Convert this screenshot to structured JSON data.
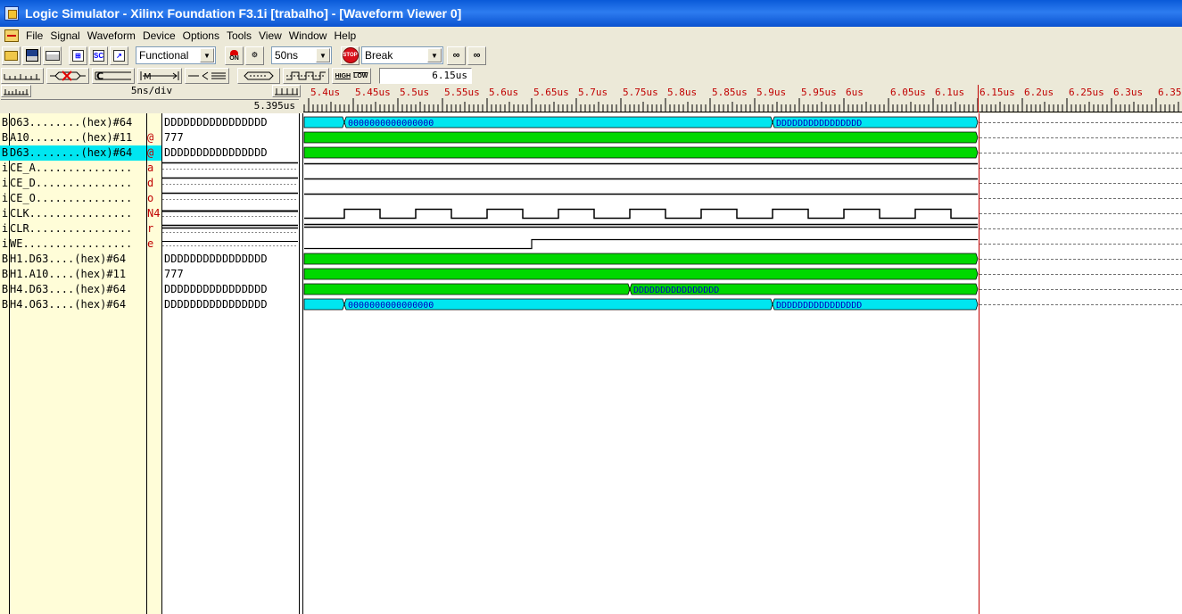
{
  "title_bar": {
    "title": "Logic Simulator - Xilinx Foundation F3.1i [trabalho] - [Waveform Viewer 0]"
  },
  "menu": [
    "File",
    "Signal",
    "Waveform",
    "Device",
    "Options",
    "Tools",
    "View",
    "Window",
    "Help"
  ],
  "toolbar": {
    "sim_mode": "Functional",
    "step_size": "50ns",
    "break_mode": "Break",
    "on_label": "ON",
    "sc_label": "SC",
    "stop_label": "STOP"
  },
  "waveform_toolbar": {
    "high_low_label_1": "HIGH",
    "high_low_label_2": "LOW",
    "time_value": "6.15us"
  },
  "header": {
    "scale": "5ns/div",
    "cursor_time": "5.395us"
  },
  "ruler": {
    "labels": [
      "5.4us",
      "5.45us",
      "5.5us",
      "5.55us",
      "5.6us",
      "5.65us",
      "5.7us",
      "5.75us",
      "5.8us",
      "5.85us",
      "5.9us",
      "5.95us",
      "6us",
      "6.05us",
      "6.1us",
      "6.15us",
      "6.2us",
      "6.25us",
      "6.3us",
      "6.35"
    ],
    "label_times": [
      5.4,
      5.45,
      5.5,
      5.55,
      5.6,
      5.65,
      5.7,
      5.75,
      5.8,
      5.85,
      5.9,
      5.95,
      6.0,
      6.05,
      6.1,
      6.15,
      6.2,
      6.25,
      6.3,
      6.35
    ],
    "start_time": 5.395,
    "end_marker": 6.15
  },
  "signals": [
    {
      "type": "B",
      "name": "O63........(hex)#64",
      "stim": "",
      "value": "DDDDDDDDDDDDDDDD",
      "kind": "bus",
      "color": "#00e6f0",
      "segments": [
        {
          "to": 5.44,
          "label": ""
        },
        {
          "to": 5.92,
          "label": "0000000000000000"
        },
        {
          "to": 6.15,
          "label": "DDDDDDDDDDDDDDDD"
        }
      ]
    },
    {
      "type": "B",
      "name": "A10........(hex)#11",
      "stim": "@",
      "value": "777",
      "kind": "bus",
      "color": "#00d800",
      "segments": [
        {
          "to": 6.15,
          "label": ""
        }
      ]
    },
    {
      "type": "B",
      "name": "D63........(hex)#64",
      "stim": "@",
      "value": "DDDDDDDDDDDDDDDD",
      "kind": "bus",
      "color": "#00d800",
      "selected": true,
      "segments": [
        {
          "to": 6.15,
          "label": ""
        }
      ]
    },
    {
      "type": "i",
      "name": "CE_A...............",
      "stim": "a",
      "value": "",
      "kind": "bit",
      "level": "high"
    },
    {
      "type": "i",
      "name": "CE_D...............",
      "stim": "d",
      "value": "",
      "kind": "bit",
      "level": "high"
    },
    {
      "type": "i",
      "name": "CE_O...............",
      "stim": "o",
      "value": "",
      "kind": "bit",
      "level": "high"
    },
    {
      "type": "i",
      "name": "CLK................",
      "stim": "N4",
      "value": "",
      "kind": "clock",
      "period": 0.08,
      "first_rise": 5.44
    },
    {
      "type": "i",
      "name": "CLR................",
      "stim": "r",
      "value": "",
      "kind": "bit",
      "level": "high2"
    },
    {
      "type": "i",
      "name": "WE.................",
      "stim": "e",
      "value": "",
      "kind": "step",
      "rise": 5.65
    },
    {
      "type": "B",
      "name": "H1.D63....(hex)#64",
      "stim": "",
      "value": "DDDDDDDDDDDDDDDD",
      "kind": "bus",
      "color": "#00d800",
      "segments": [
        {
          "to": 6.15,
          "label": ""
        }
      ]
    },
    {
      "type": "B",
      "name": "H1.A10....(hex)#11",
      "stim": "",
      "value": "777",
      "kind": "bus",
      "color": "#00d800",
      "segments": [
        {
          "to": 6.15,
          "label": ""
        }
      ]
    },
    {
      "type": "B",
      "name": "H4.D63....(hex)#64",
      "stim": "",
      "value": "DDDDDDDDDDDDDDDD",
      "kind": "bus",
      "color": "#00d800",
      "segments": [
        {
          "to": 5.76,
          "label": ""
        },
        {
          "to": 6.15,
          "label": "DDDDDDDDDDDDDDDD"
        }
      ]
    },
    {
      "type": "B",
      "name": "H4.O63....(hex)#64",
      "stim": "",
      "value": "DDDDDDDDDDDDDDDD",
      "kind": "bus",
      "color": "#00e6f0",
      "segments": [
        {
          "to": 5.44,
          "label": ""
        },
        {
          "to": 5.92,
          "label": "0000000000000000"
        },
        {
          "to": 6.15,
          "label": "DDDDDDDDDDDDDDDD"
        }
      ]
    }
  ]
}
